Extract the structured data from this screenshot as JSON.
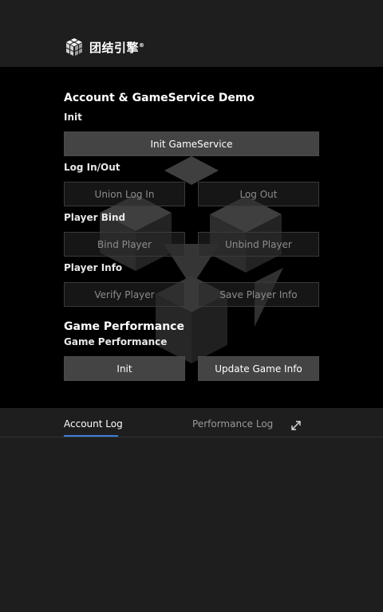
{
  "brand": {
    "name": "团结引擎",
    "registered": "®"
  },
  "demo": {
    "title": "Account & GameService Demo",
    "sections": {
      "init": {
        "label": "Init",
        "button": "Init GameService"
      },
      "login": {
        "label": "Log In/Out",
        "buttons": [
          "Union Log In",
          "Log Out"
        ]
      },
      "bind": {
        "label": "Player Bind",
        "buttons": [
          "Bind Player",
          "Unbind Player"
        ]
      },
      "info": {
        "label": "Player Info",
        "buttons": [
          "Verify Player",
          "Save Player Info"
        ]
      }
    }
  },
  "performance": {
    "title": "Game Performance",
    "label": "Game Performance",
    "buttons": [
      "Init",
      "Update Game Info"
    ]
  },
  "log_panel": {
    "tabs": [
      "Account Log",
      "Performance Log"
    ],
    "active_tab": "Account Log",
    "expand_icon": "expand-icon"
  },
  "colors": {
    "accent": "#3d7fd6",
    "button": "#444444",
    "panel": "#1e1e1e",
    "background": "#000000"
  }
}
